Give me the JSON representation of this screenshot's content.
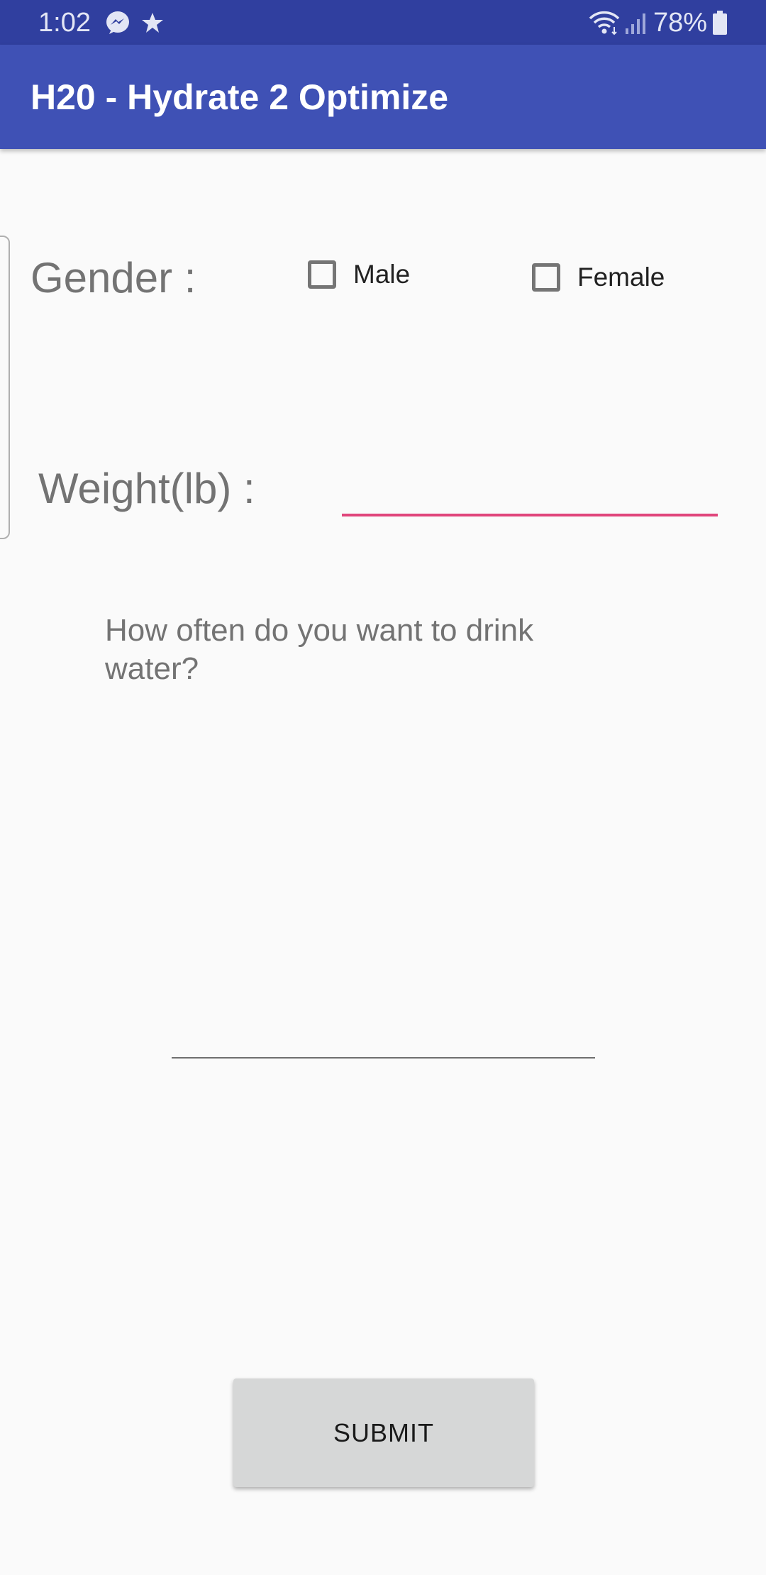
{
  "status_bar": {
    "time": "1:02",
    "battery": "78%",
    "icons": [
      "messenger-icon",
      "star-icon",
      "wifi-icon",
      "signal-icon",
      "battery-icon"
    ]
  },
  "app_bar": {
    "title": "H20 - Hydrate 2 Optimize"
  },
  "form": {
    "gender_label": "Gender :",
    "male_label": "Male",
    "female_label": "Female",
    "male_checked": false,
    "female_checked": false,
    "weight_label": "Weight(lb) :",
    "weight_value": "",
    "question": "How often do you want to drink water?",
    "frequency_value": "",
    "submit_label": "SUBMIT"
  },
  "colors": {
    "status_bar": "#303f9f",
    "app_bar": "#3f51b5",
    "accent": "#e0457b",
    "background": "#fafafa",
    "button": "#d6d7d7"
  }
}
